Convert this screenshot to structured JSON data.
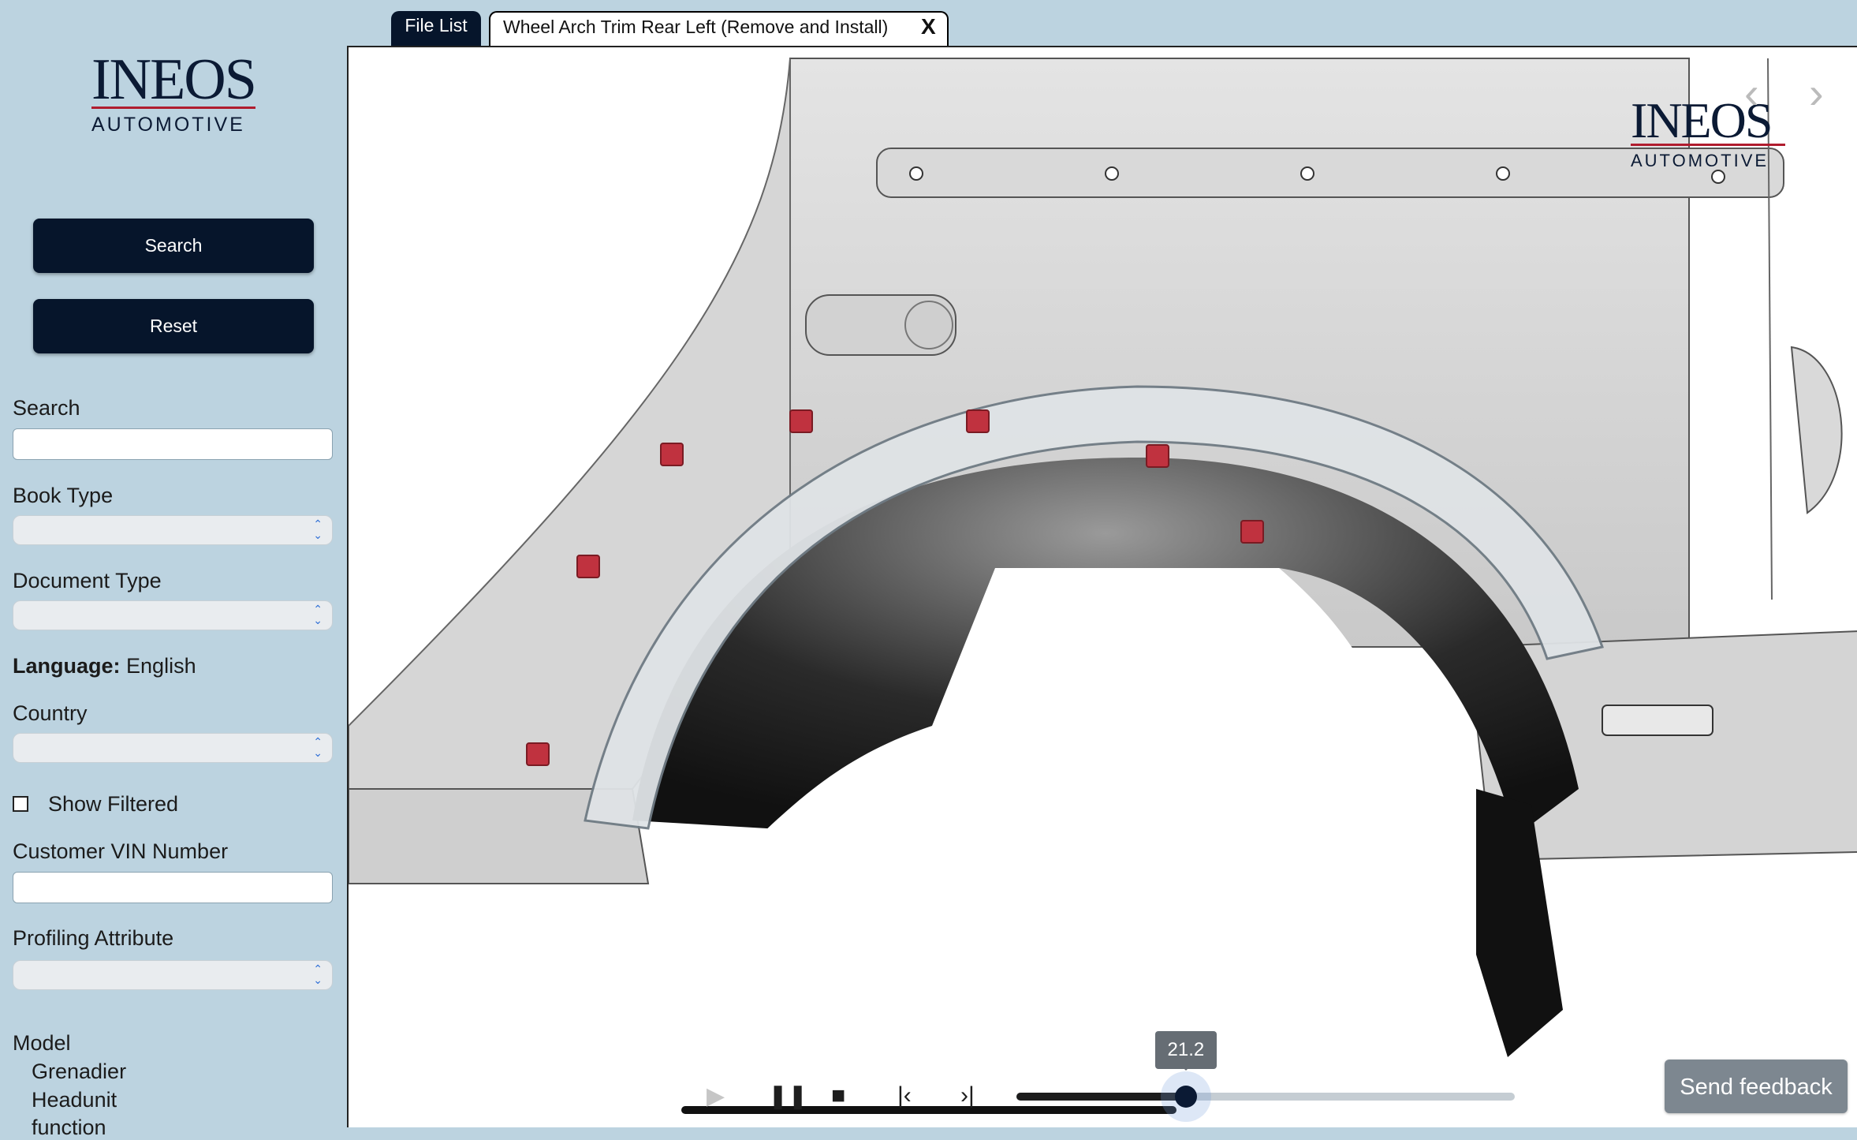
{
  "brand": {
    "name": "INEOS",
    "subtitle": "AUTOMOTIVE"
  },
  "sidebar": {
    "search_button": "Search",
    "reset_button": "Reset",
    "search_label": "Search",
    "search_value": "",
    "book_type_label": "Book Type",
    "document_type_label": "Document Type",
    "language_label": "Language:",
    "language_value": "English",
    "country_label": "Country",
    "show_filtered_label": "Show Filtered",
    "show_filtered_checked": false,
    "vin_label": "Customer VIN Number",
    "vin_value": "",
    "profiling_label": "Profiling Attribute",
    "model_label": "Model",
    "model_items": [
      "Grenadier",
      "Headunit",
      "function"
    ]
  },
  "tabs": {
    "file_list": "File List",
    "document": "Wheel Arch Trim Rear Left (Remove and Install)",
    "close": "X"
  },
  "viewer": {
    "prev_arrow": "‹",
    "next_arrow": "›"
  },
  "player": {
    "play_icon": "play-icon",
    "pause_icon": "pause-icon",
    "stop_icon": "stop-icon",
    "prev_icon": "skip-back-icon",
    "next_icon": "skip-forward-icon",
    "progress_fraction": 0.34,
    "tooltip": "21.2"
  },
  "feedback_button": "Send feedback",
  "colors": {
    "sidebar_bg": "#bcd3e0",
    "button_bg": "#06152b",
    "brand_red": "#b01c2e",
    "clip_red": "#c0323f"
  }
}
